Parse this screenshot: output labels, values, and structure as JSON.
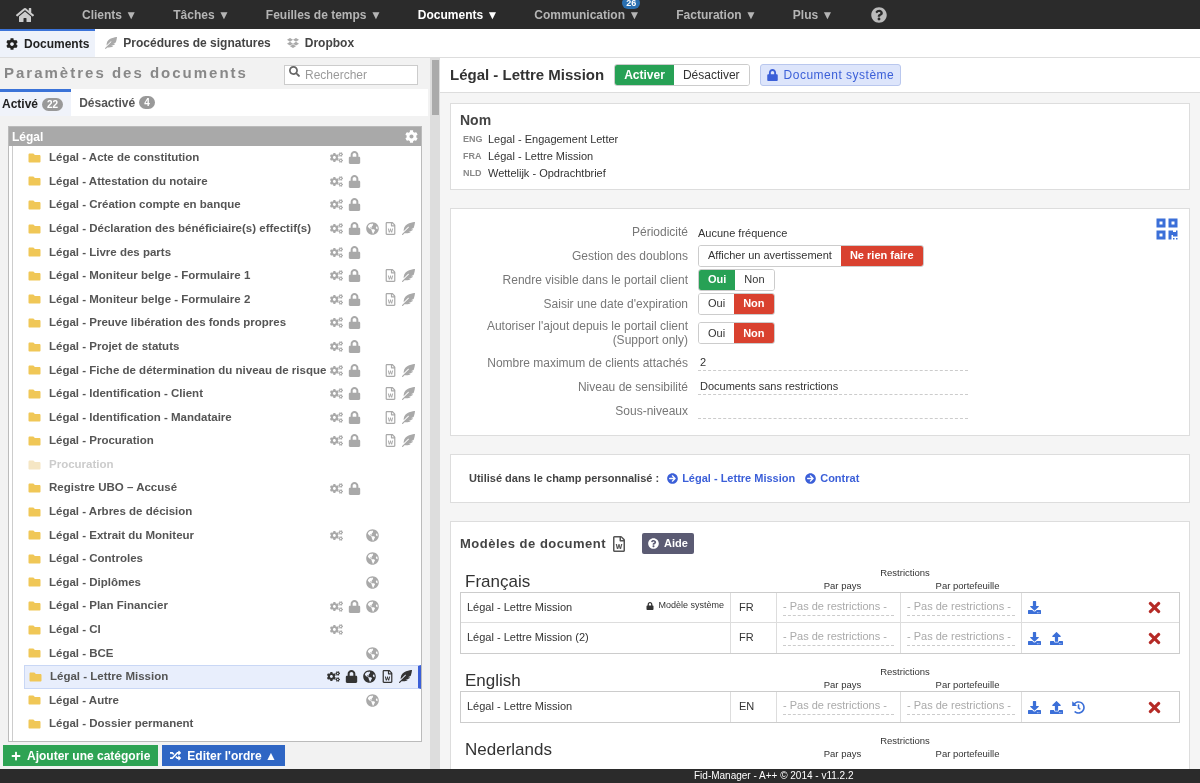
{
  "nav": {
    "items": [
      {
        "label": "Clients",
        "selected": false
      },
      {
        "label": "Tâches",
        "selected": false
      },
      {
        "label": "Feuilles de temps",
        "selected": false
      },
      {
        "label": "Documents",
        "selected": true
      },
      {
        "label": "Communication",
        "selected": false,
        "badge": "26"
      },
      {
        "label": "Facturation",
        "selected": false
      },
      {
        "label": "Plus",
        "selected": false
      }
    ],
    "caret": "▼"
  },
  "subnav": [
    {
      "label": "Documents",
      "selected": true
    },
    {
      "label": "Procédures de signatures",
      "selected": false
    },
    {
      "label": "Dropbox",
      "selected": false
    }
  ],
  "left": {
    "title": "Paramètres des documents",
    "search": {
      "placeholder": "Rechercher"
    },
    "tabs": [
      {
        "label": "Activé",
        "count": "22",
        "selected": true
      },
      {
        "label": "Désactivé",
        "count": "4",
        "selected": false
      }
    ],
    "category": "Légal",
    "items": [
      {
        "label": "Légal - Acte de constitution",
        "automated": true,
        "locked": true,
        "portal": false,
        "word": false,
        "signature": false,
        "selected": false,
        "disabled": false
      },
      {
        "label": "Légal - Attestation du notaire",
        "automated": true,
        "locked": true,
        "portal": false,
        "word": false,
        "signature": false,
        "selected": false,
        "disabled": false
      },
      {
        "label": "Légal - Création compte en banque",
        "automated": true,
        "locked": true,
        "portal": false,
        "word": false,
        "signature": false,
        "selected": false,
        "disabled": false
      },
      {
        "label": "Légal - Déclaration des bénéficiaire(s) effectif(s)",
        "automated": true,
        "locked": true,
        "portal": true,
        "word": true,
        "signature": true,
        "selected": false,
        "disabled": false
      },
      {
        "label": "Légal - Livre des parts",
        "automated": true,
        "locked": true,
        "portal": false,
        "word": false,
        "signature": false,
        "selected": false,
        "disabled": false
      },
      {
        "label": "Légal - Moniteur belge - Formulaire 1",
        "automated": true,
        "locked": true,
        "portal": false,
        "word": true,
        "signature": true,
        "selected": false,
        "disabled": false
      },
      {
        "label": "Légal - Moniteur belge - Formulaire 2",
        "automated": true,
        "locked": true,
        "portal": false,
        "word": true,
        "signature": true,
        "selected": false,
        "disabled": false
      },
      {
        "label": "Légal - Preuve libération des fonds propres",
        "automated": true,
        "locked": true,
        "portal": false,
        "word": false,
        "signature": false,
        "selected": false,
        "disabled": false
      },
      {
        "label": "Légal - Projet de statuts",
        "automated": true,
        "locked": true,
        "portal": false,
        "word": false,
        "signature": false,
        "selected": false,
        "disabled": false
      },
      {
        "label": "Légal - Fiche de détermination du niveau de risque",
        "automated": true,
        "locked": true,
        "portal": false,
        "word": true,
        "signature": true,
        "selected": false,
        "disabled": false
      },
      {
        "label": "Légal - Identification - Client",
        "automated": true,
        "locked": true,
        "portal": false,
        "word": true,
        "signature": true,
        "selected": false,
        "disabled": false
      },
      {
        "label": "Légal - Identification - Mandataire",
        "automated": true,
        "locked": true,
        "portal": false,
        "word": true,
        "signature": true,
        "selected": false,
        "disabled": false
      },
      {
        "label": "Légal - Procuration",
        "automated": true,
        "locked": true,
        "portal": false,
        "word": true,
        "signature": true,
        "selected": false,
        "disabled": false
      },
      {
        "label": "Procuration",
        "automated": false,
        "locked": false,
        "portal": false,
        "word": false,
        "signature": false,
        "selected": false,
        "disabled": true
      },
      {
        "label": "Registre UBO – Accusé",
        "automated": true,
        "locked": true,
        "portal": false,
        "word": false,
        "signature": false,
        "selected": false,
        "disabled": false
      },
      {
        "label": "Légal - Arbres de décision",
        "automated": false,
        "locked": false,
        "portal": false,
        "word": false,
        "signature": false,
        "selected": false,
        "disabled": false
      },
      {
        "label": "Légal - Extrait du Moniteur",
        "automated": true,
        "locked": false,
        "portal": true,
        "word": false,
        "signature": false,
        "selected": false,
        "disabled": false
      },
      {
        "label": "Légal - Controles",
        "automated": false,
        "locked": false,
        "portal": true,
        "word": false,
        "signature": false,
        "selected": false,
        "disabled": false
      },
      {
        "label": "Légal - Diplômes",
        "automated": false,
        "locked": false,
        "portal": true,
        "word": false,
        "signature": false,
        "selected": false,
        "disabled": false
      },
      {
        "label": "Légal - Plan Financier",
        "automated": true,
        "locked": true,
        "portal": true,
        "word": false,
        "signature": false,
        "selected": false,
        "disabled": false
      },
      {
        "label": "Légal - CI",
        "automated": true,
        "locked": false,
        "portal": false,
        "word": false,
        "signature": false,
        "selected": false,
        "disabled": false
      },
      {
        "label": "Légal - BCE",
        "automated": false,
        "locked": false,
        "portal": true,
        "word": false,
        "signature": false,
        "selected": false,
        "disabled": false
      },
      {
        "label": "Légal - Lettre Mission",
        "automated": true,
        "locked": true,
        "portal": true,
        "word": true,
        "signature": true,
        "selected": true,
        "disabled": false
      },
      {
        "label": "Légal - Autre",
        "automated": false,
        "locked": false,
        "portal": true,
        "word": false,
        "signature": false,
        "selected": false,
        "disabled": false
      },
      {
        "label": "Légal - Dossier permanent",
        "automated": false,
        "locked": false,
        "portal": false,
        "word": false,
        "signature": false,
        "selected": false,
        "disabled": false
      }
    ],
    "buttons": [
      {
        "label": "Ajouter une catégorie",
        "kind": "add"
      },
      {
        "label": "Editer l'ordre",
        "kind": "order",
        "caret": "▲"
      }
    ]
  },
  "detail": {
    "title": "Légal - Lettre Mission",
    "state": [
      {
        "label": "Activer",
        "selected": true
      },
      {
        "label": "Désactiver",
        "selected": false
      }
    ],
    "system_badge": "Document système",
    "names": {
      "title": "Nom",
      "rows": [
        {
          "lang": "ENG",
          "value": "Legal - Engagement Letter"
        },
        {
          "lang": "FRA",
          "value": "Légal - Lettre Mission"
        },
        {
          "lang": "NLD",
          "value": "Wettelijk - Opdrachtbrief"
        }
      ]
    },
    "settings": [
      {
        "label": "Périodicité",
        "kind": "text",
        "value": "Aucune fréquence"
      },
      {
        "label": "Gestion des doublons",
        "kind": "toggle",
        "color": "#d9412f",
        "options": [
          {
            "label": "Afficher un avertissement",
            "selected": false
          },
          {
            "label": "Ne rien faire",
            "selected": true
          }
        ]
      },
      {
        "label": "Rendre visible dans le portail client",
        "kind": "toggle",
        "color": "#27a155",
        "options": [
          {
            "label": "Oui",
            "selected": true
          },
          {
            "label": "Non",
            "selected": false
          }
        ]
      },
      {
        "label": "Saisir une date d'expiration",
        "kind": "toggle",
        "color": "#d9412f",
        "options": [
          {
            "label": "Oui",
            "selected": false
          },
          {
            "label": "Non",
            "selected": true
          }
        ]
      },
      {
        "label": "Autoriser l'ajout depuis le portail client",
        "sublabel": "(Support only)",
        "kind": "toggle",
        "color": "#d9412f",
        "options": [
          {
            "label": "Oui",
            "selected": false
          },
          {
            "label": "Non",
            "selected": true
          }
        ]
      },
      {
        "label": "Nombre maximum de clients attachés",
        "kind": "field",
        "value": "2"
      },
      {
        "label": "Niveau de sensibilité",
        "kind": "field",
        "value": "Documents sans restrictions"
      },
      {
        "label": "Sous-niveaux",
        "kind": "field"
      }
    ],
    "custom_field": {
      "label": "Utilisé dans le champ personnalisé :",
      "links": [
        "Légal - Lettre Mission",
        "Contrat"
      ]
    },
    "models": {
      "title": "Modèles de document",
      "help": "Aide",
      "sections": [
        {
          "language": "Français",
          "restrictions": "Restrictions",
          "col_country": "Par pays",
          "col_portfolio": "Par portefeuille",
          "rows": [
            {
              "name": "Légal - Lettre Mission",
              "system": "Modèle système",
              "lang": "FR",
              "country": "- Pas de restrictions -",
              "portfolio": "- Pas de restrictions -",
              "download": true,
              "upload": false,
              "history": false
            },
            {
              "name": "Légal - Lettre Mission (2)",
              "lang": "FR",
              "country": "- Pas de restrictions -",
              "portfolio": "- Pas de restrictions -",
              "download": true,
              "upload": true,
              "history": false
            }
          ]
        },
        {
          "language": "English",
          "restrictions": "Restrictions",
          "col_country": "Par pays",
          "col_portfolio": "Par portefeuille",
          "rows": [
            {
              "name": "Légal - Lettre Mission",
              "lang": "EN",
              "country": "- Pas de restrictions -",
              "portfolio": "- Pas de restrictions -",
              "download": true,
              "upload": true,
              "history": true
            }
          ]
        },
        {
          "language": "Nederlands",
          "restrictions": "Restrictions",
          "col_country": "Par pays",
          "col_portfolio": "Par portefeuille"
        }
      ]
    }
  },
  "footer": "Fid-Manager - A++ © 2014 - v11.2.2"
}
